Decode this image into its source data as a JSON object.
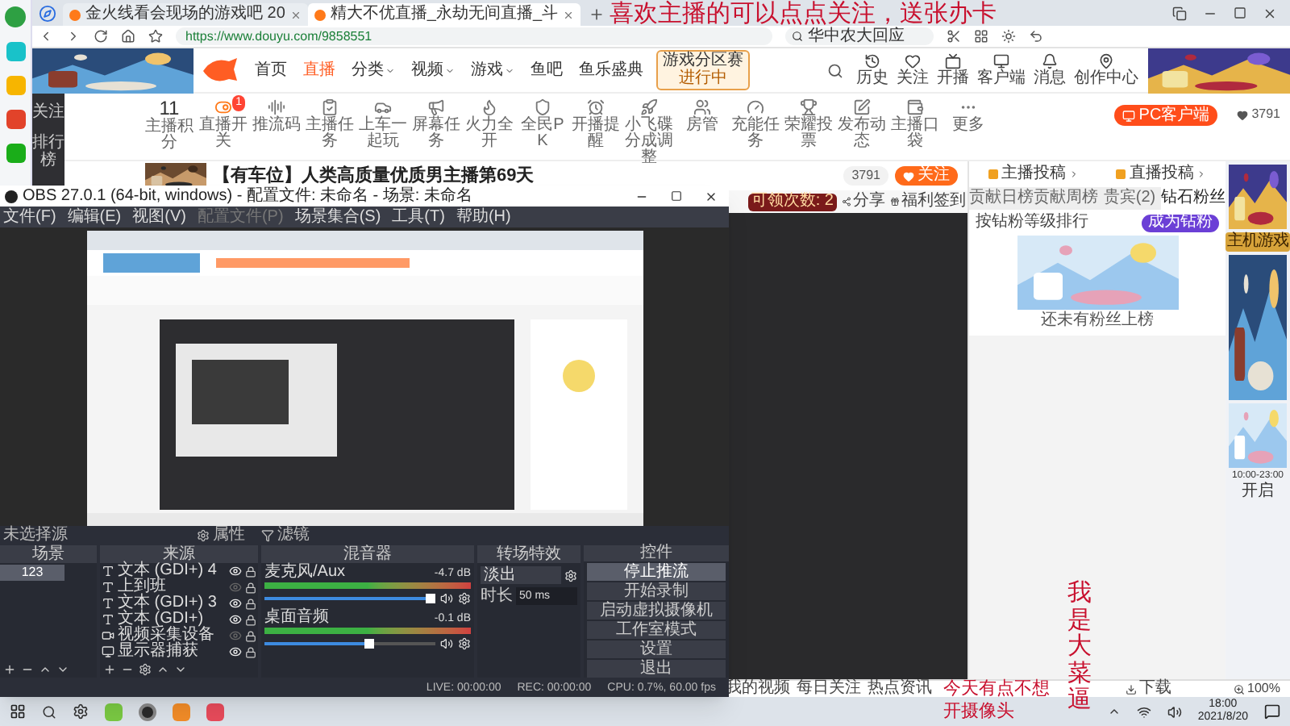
{
  "browser": {
    "tabs": [
      {
        "title": "金火线看会现场的游戏吧 20",
        "selected": false
      },
      {
        "title": "精大不优直播_永劫无间直播_斗",
        "selected": true
      }
    ],
    "address": {
      "url": "https://www.douyu.com/9858551",
      "search": "华中农大回应"
    }
  },
  "header": {
    "nav": [
      {
        "label": "首页",
        "selected": false,
        "dropdown": false
      },
      {
        "label": "直播",
        "selected": true,
        "dropdown": false
      },
      {
        "label": "分类",
        "selected": false,
        "dropdown": true
      },
      {
        "label": "视频",
        "selected": false,
        "dropdown": true
      },
      {
        "label": "游戏",
        "selected": false,
        "dropdown": true
      },
      {
        "label": "鱼吧",
        "selected": false,
        "dropdown": false
      },
      {
        "label": "鱼乐盛典",
        "selected": false,
        "dropdown": false
      }
    ],
    "event_badge": {
      "title": "游戏分区赛",
      "status": "进行中"
    },
    "user_menu": [
      "历史",
      "关注",
      "开播",
      "客户端",
      "消息",
      "创作中心"
    ]
  },
  "left_nav": [
    "关注",
    "排行榜"
  ],
  "toolbar": {
    "score": "11",
    "score_label": "主播积分",
    "items": [
      {
        "label": "直播开关",
        "badge": "1"
      },
      {
        "label": "推流码"
      },
      {
        "label": "主播任务"
      },
      {
        "label": "上车一起玩"
      },
      {
        "label": "屏幕任务"
      },
      {
        "label": "火力全开"
      },
      {
        "label": "全民PK"
      },
      {
        "label": "开播提醒"
      },
      {
        "label": "小飞碟分成调整"
      },
      {
        "label": "房管"
      },
      {
        "label": "充能任务"
      },
      {
        "label": "荣耀投票"
      },
      {
        "label": "发布动态"
      },
      {
        "label": "主播口袋"
      },
      {
        "label": "更多"
      }
    ],
    "client_button": "PC客户端",
    "hearts": "3791"
  },
  "room": {
    "title": "【有车位】人类高质量优质男主播第69天",
    "followers": "3791",
    "follow_button": "关注",
    "claims": "可领次数: 2",
    "share": "分享",
    "checkin": "福利签到"
  },
  "panel": {
    "links": [
      "主播投稿",
      "直播投稿"
    ],
    "tabs": [
      {
        "label": "贡献日榜",
        "selected": false
      },
      {
        "label": "贡献周榜",
        "selected": false
      },
      {
        "label": "贵宾(2)",
        "selected": false
      },
      {
        "label": "钻石粉丝",
        "selected": true
      }
    ],
    "hint": "按钻粉等级排行",
    "join_button": "成为钻粉",
    "empty": "还未有粉丝上榜"
  },
  "ads": {
    "top": "主机游戏",
    "time": "10:00-23:00",
    "action": "开启"
  },
  "status_bar": {
    "left": [
      "我的视频",
      "每日关注",
      "热点资讯"
    ],
    "download": "下载",
    "zoom": "100%"
  },
  "obs": {
    "title": "OBS 27.0.1 (64-bit, windows) - 配置文件: 未命名 - 场景: 未命名",
    "menu": [
      {
        "label": "文件(F)",
        "disabled": false
      },
      {
        "label": "编辑(E)",
        "disabled": false
      },
      {
        "label": "视图(V)",
        "disabled": false
      },
      {
        "label": "配置文件(P)",
        "disabled": true
      },
      {
        "label": "场景集合(S)",
        "disabled": false
      },
      {
        "label": "工具(T)",
        "disabled": false
      },
      {
        "label": "帮助(H)",
        "disabled": false
      }
    ],
    "source_bar": {
      "label": "未选择源",
      "properties": "属性",
      "filters": "滤镜"
    },
    "scenes": {
      "title": "场景",
      "items": [
        {
          "name": "123",
          "selected": true
        }
      ]
    },
    "sources": {
      "title": "来源",
      "items": [
        {
          "kind": "text",
          "name": "文本 (GDI+) 4",
          "visible": true
        },
        {
          "kind": "text",
          "name": "上到班",
          "visible": false
        },
        {
          "kind": "text",
          "name": "文本 (GDI+) 3",
          "visible": true
        },
        {
          "kind": "text",
          "name": "文本 (GDI+)",
          "visible": true
        },
        {
          "kind": "camera",
          "name": "视频采集设备",
          "visible": false
        },
        {
          "kind": "display",
          "name": "显示器捕获",
          "visible": true
        }
      ]
    },
    "mixer": {
      "title": "混音器",
      "channels": [
        {
          "name": "麦克风/Aux",
          "reading": "-4.7 dB",
          "level": 1,
          "muted": false
        },
        {
          "name": "桌面音频",
          "reading": "-0.1 dB",
          "level": 0.62,
          "muted": false
        }
      ]
    },
    "transition": {
      "title": "转场特效",
      "type": "淡出",
      "duration_label": "时长",
      "duration": "50 ms"
    },
    "controls": {
      "title": "控件",
      "buttons": [
        {
          "label": "停止推流",
          "active": true
        },
        {
          "label": "开始录制",
          "active": false
        },
        {
          "label": "启动虚拟摄像机",
          "active": false
        },
        {
          "label": "工作室模式",
          "active": false
        },
        {
          "label": "设置",
          "active": false
        },
        {
          "label": "退出",
          "active": false
        }
      ]
    },
    "status": {
      "live": "LIVE: 00:00:00",
      "rec": "REC: 00:00:00",
      "cpu": "CPU: 0.7%, 60.00 fps"
    }
  },
  "overlays": {
    "top": "喜欢主播的可以点点关注，送张办卡",
    "vertical": "我是大菜逼",
    "bottom": "今天有点不想开摄像头"
  },
  "taskbar": {
    "time": "18:00",
    "date": "2021/8/20"
  }
}
